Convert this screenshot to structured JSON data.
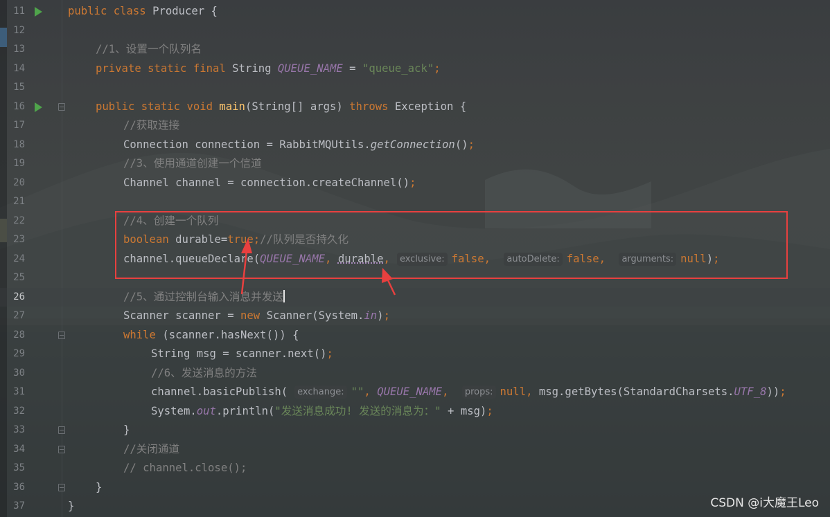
{
  "editor": {
    "lines": [
      {
        "n": "11",
        "run": true,
        "fold": false,
        "current": false
      },
      {
        "n": "12",
        "run": false,
        "fold": false,
        "current": false
      },
      {
        "n": "13",
        "run": false,
        "fold": false,
        "current": false
      },
      {
        "n": "14",
        "run": false,
        "fold": false,
        "current": false
      },
      {
        "n": "15",
        "run": false,
        "fold": false,
        "current": false
      },
      {
        "n": "16",
        "run": true,
        "fold": true,
        "current": false
      },
      {
        "n": "17",
        "run": false,
        "fold": false,
        "current": false
      },
      {
        "n": "18",
        "run": false,
        "fold": false,
        "current": false
      },
      {
        "n": "19",
        "run": false,
        "fold": false,
        "current": false
      },
      {
        "n": "20",
        "run": false,
        "fold": false,
        "current": false
      },
      {
        "n": "21",
        "run": false,
        "fold": false,
        "current": false
      },
      {
        "n": "22",
        "run": false,
        "fold": false,
        "current": false
      },
      {
        "n": "23",
        "run": false,
        "fold": false,
        "current": false
      },
      {
        "n": "24",
        "run": false,
        "fold": false,
        "current": false
      },
      {
        "n": "25",
        "run": false,
        "fold": false,
        "current": false
      },
      {
        "n": "26",
        "run": false,
        "fold": false,
        "current": true
      },
      {
        "n": "27",
        "run": false,
        "fold": false,
        "current": false
      },
      {
        "n": "28",
        "run": false,
        "fold": true,
        "current": false
      },
      {
        "n": "29",
        "run": false,
        "fold": false,
        "current": false
      },
      {
        "n": "30",
        "run": false,
        "fold": false,
        "current": false
      },
      {
        "n": "31",
        "run": false,
        "fold": false,
        "current": false
      },
      {
        "n": "32",
        "run": false,
        "fold": false,
        "current": false
      },
      {
        "n": "33",
        "run": false,
        "fold": true,
        "current": false
      },
      {
        "n": "34",
        "run": false,
        "fold": true,
        "current": false
      },
      {
        "n": "35",
        "run": false,
        "fold": false,
        "current": false
      },
      {
        "n": "36",
        "run": false,
        "fold": true,
        "current": false
      },
      {
        "n": "37",
        "run": false,
        "fold": false,
        "current": false
      }
    ],
    "code": {
      "l11": [
        [
          "kw",
          "public "
        ],
        [
          "kw",
          "class "
        ],
        [
          "t",
          "Producer {"
        ]
      ],
      "l12": [],
      "l13": [
        [
          "cmt",
          "//1、设置一个队列名"
        ]
      ],
      "l14": [
        [
          "kw",
          "private "
        ],
        [
          "kw",
          "static "
        ],
        [
          "kw",
          "final "
        ],
        [
          "t",
          "String "
        ],
        [
          "const",
          "QUEUE_NAME"
        ],
        [
          "t",
          " = "
        ],
        [
          "str",
          "\"queue_ack\""
        ],
        [
          "kw",
          ";"
        ]
      ],
      "l15": [],
      "l16": [
        [
          "kw",
          "public "
        ],
        [
          "kw",
          "static "
        ],
        [
          "kw",
          "void "
        ],
        [
          "method",
          "main"
        ],
        [
          "t",
          "(String[] args) "
        ],
        [
          "kw",
          "throws "
        ],
        [
          "t",
          "Exception {"
        ]
      ],
      "l17": [
        [
          "cmt",
          "//获取连接"
        ]
      ],
      "l18": [
        [
          "t",
          "Connection connection = RabbitMQUtils."
        ],
        [
          "ital",
          "getConnection"
        ],
        [
          "t",
          "()"
        ],
        [
          "kw",
          ";"
        ]
      ],
      "l19": [
        [
          "cmt",
          "//3、使用通道创建一个信道"
        ]
      ],
      "l20": [
        [
          "t",
          "Channel channel = connection.createChannel()"
        ],
        [
          "kw",
          ";"
        ]
      ],
      "l21": [],
      "l22": [
        [
          "cmt",
          "//4、创建一个队列"
        ]
      ],
      "l23": [
        [
          "kw",
          "boolean "
        ],
        [
          "t",
          "durable="
        ],
        [
          "kw",
          "true;"
        ],
        [
          "cmt",
          "//队列是否持久化"
        ]
      ],
      "l24": [
        [
          "t",
          "channel.queueDeclare("
        ],
        [
          "const",
          "QUEUE_NAME"
        ],
        [
          "kw",
          ", "
        ],
        [
          "uvar",
          "durable"
        ],
        [
          "kw",
          ","
        ],
        [
          "hint",
          "exclusive:"
        ],
        [
          "kw",
          "false, "
        ],
        [
          "hint",
          "autoDelete:"
        ],
        [
          "kw",
          "false, "
        ],
        [
          "hint",
          "arguments:"
        ],
        [
          "kw",
          "null"
        ],
        [
          "t",
          ")"
        ],
        [
          "kw",
          ";"
        ]
      ],
      "l25": [],
      "l26": [
        [
          "cmt",
          "//5、通过控制台输入消息并发送"
        ],
        [
          "caret",
          ""
        ]
      ],
      "l27": [
        [
          "t",
          "Scanner scanner = "
        ],
        [
          "kw",
          "new "
        ],
        [
          "t",
          "Scanner(System."
        ],
        [
          "const",
          "in"
        ],
        [
          "t",
          ")"
        ],
        [
          "kw",
          ";"
        ]
      ],
      "l28": [
        [
          "kw",
          "while "
        ],
        [
          "t",
          "(scanner.hasNext()) {"
        ]
      ],
      "l29": [
        [
          "t",
          "String msg = scanner.next()"
        ],
        [
          "kw",
          ";"
        ]
      ],
      "l30": [
        [
          "cmt",
          "//6、发送消息的方法"
        ]
      ],
      "l31": [
        [
          "t",
          "channel.basicPublish("
        ],
        [
          "hint",
          "exchange:"
        ],
        [
          "str",
          "\"\""
        ],
        [
          "kw",
          ", "
        ],
        [
          "const",
          "QUEUE_NAME"
        ],
        [
          "kw",
          ", "
        ],
        [
          "hint",
          "props:"
        ],
        [
          "kw",
          "null, "
        ],
        [
          "t",
          "msg.getBytes(StandardCharsets."
        ],
        [
          "const",
          "UTF_8"
        ],
        [
          "t",
          "))"
        ],
        [
          "kw",
          ";"
        ]
      ],
      "l32": [
        [
          "t",
          "System."
        ],
        [
          "const",
          "out"
        ],
        [
          "t",
          ".println("
        ],
        [
          "str",
          "\"发送消息成功! 发送的消息为："
        ],
        [
          "str",
          "\""
        ],
        [
          "t",
          " + msg)"
        ],
        [
          "kw",
          ";"
        ]
      ],
      "l33": [
        [
          "t",
          "}"
        ]
      ],
      "l34": [
        [
          "cmt",
          "//关闭通道"
        ]
      ],
      "l35": [
        [
          "cmt",
          "// channel.close();"
        ]
      ],
      "l36": [
        [
          "t",
          "}"
        ]
      ],
      "l37": [
        [
          "t",
          "}"
        ]
      ]
    }
  },
  "colors": {
    "keyword": "#cc7832",
    "string": "#6a8759",
    "comment": "#808080",
    "constant": "#9876aa",
    "highlight_box": "#e8403f",
    "run_icon": "#4fa44b"
  },
  "watermark": "CSDN @i大魔王Leo"
}
